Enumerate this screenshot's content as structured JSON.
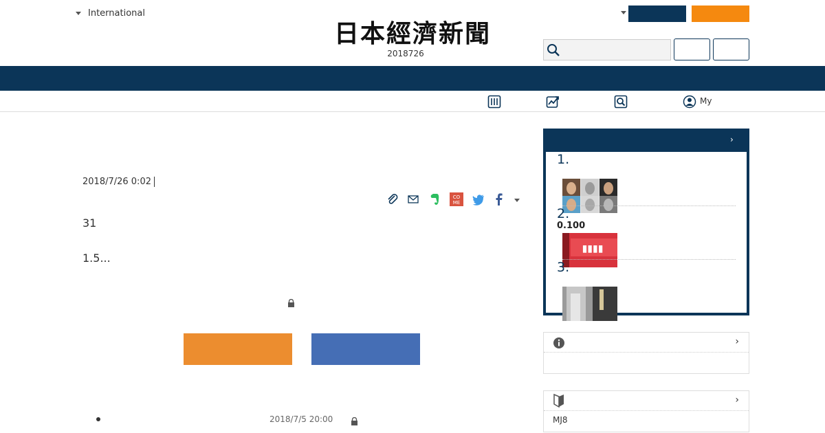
{
  "header": {
    "edition": "International",
    "logo": "日本經濟新聞",
    "date": "2018726"
  },
  "subnav": {
    "my_label": "My"
  },
  "article": {
    "date": "2018/7/26 0:02",
    "paragraph_1": "31",
    "paragraph_2": "1.5..."
  },
  "related": {
    "date": "2018/7/5 20:00"
  },
  "ranking": {
    "chevron": "›",
    "items": [
      {
        "num": "1.",
        "subtitle": ""
      },
      {
        "num": "2.",
        "subtitle": "0.100"
      },
      {
        "num": "3.",
        "subtitle": ""
      }
    ]
  },
  "info_box": {
    "chevron": "›"
  },
  "beginner_box": {
    "chevron": "›",
    "text": "MJ8"
  },
  "colors": {
    "navy": "#0b3558",
    "orange": "#f5890f",
    "cta_orange": "#ec8d2f",
    "cta_blue": "#456eb5"
  }
}
